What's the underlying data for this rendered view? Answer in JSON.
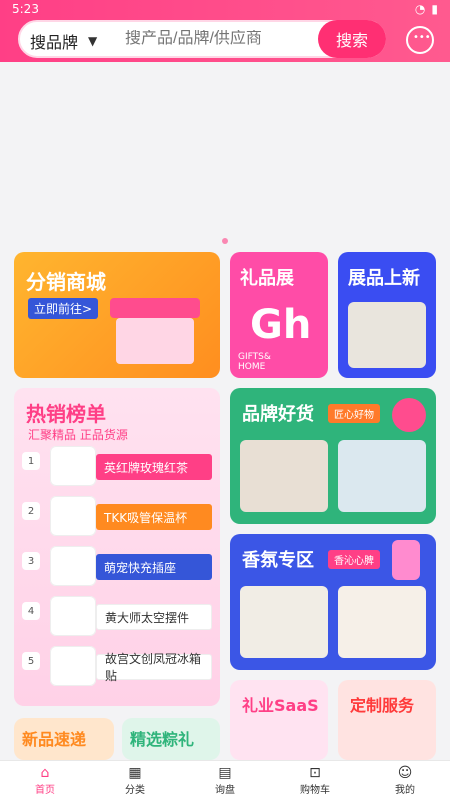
{
  "status_bar": {
    "time": "5:23"
  },
  "search": {
    "brand_select": "搜品牌",
    "placeholder": "搜产品/品牌/供应商",
    "button": "搜索"
  },
  "cards": {
    "fenxiao": {
      "title": "分销商城",
      "cta": "立即前往>"
    },
    "gift": {
      "title": "礼品展",
      "sub_1": "GIFTS&",
      "sub_2": "HOME"
    },
    "new": {
      "title": "展品上新"
    },
    "hot": {
      "title": "热销榜单",
      "subtitle": "汇聚精品  正品货源",
      "items": [
        {
          "rank": "1",
          "label": "英红牌玫瑰红茶"
        },
        {
          "rank": "2",
          "label": "TKK吸管保温杯"
        },
        {
          "rank": "3",
          "label": "萌宠快充插座"
        },
        {
          "rank": "4",
          "label": "黄大师太空摆件"
        },
        {
          "rank": "5",
          "label": "故宫文创凤冠冰箱贴"
        }
      ]
    },
    "quality": {
      "title": "品牌好货",
      "tag": "匠心好物"
    },
    "fragrance": {
      "title": "香氛专区",
      "tag": "香沁心脾"
    },
    "saas": {
      "title": "礼业SaaS"
    },
    "custom": {
      "title": "定制服务"
    },
    "new_express": {
      "title": "新品速递"
    },
    "selected": {
      "title": "精选粽礼"
    }
  },
  "tabbar": [
    {
      "label": "首页",
      "icon": "home-icon"
    },
    {
      "label": "分类",
      "icon": "grid-icon"
    },
    {
      "label": "询盘",
      "icon": "inquiry-icon"
    },
    {
      "label": "购物车",
      "icon": "cart-icon"
    },
    {
      "label": "我的",
      "icon": "user-icon"
    }
  ],
  "colors": {
    "brand_pink": "#ff3f86",
    "orange": "#ff8a20",
    "blue": "#3556d8",
    "green": "#2fb47b"
  }
}
